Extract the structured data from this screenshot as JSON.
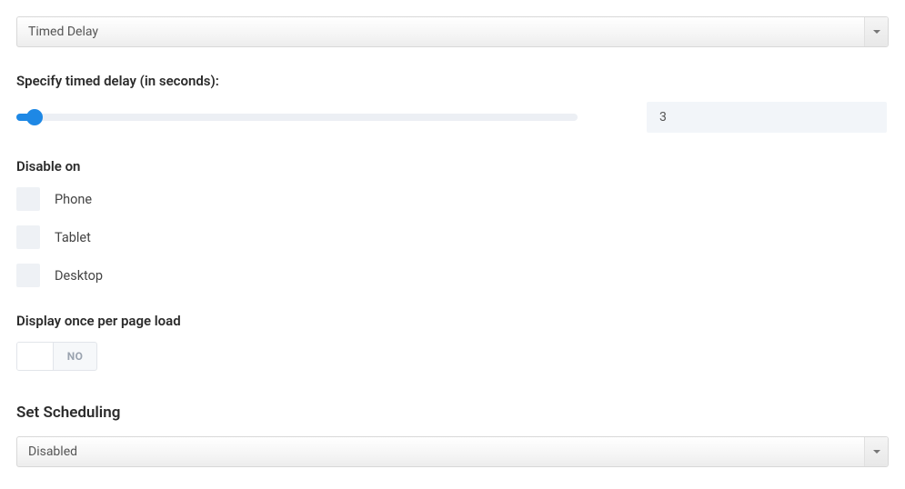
{
  "triggerSelect": {
    "value": "Timed Delay"
  },
  "delay": {
    "label": "Specify timed delay (in seconds):",
    "value": "3"
  },
  "disableOn": {
    "label": "Disable on",
    "options": [
      "Phone",
      "Tablet",
      "Desktop"
    ]
  },
  "displayOnce": {
    "label": "Display once per page load",
    "toggle": "NO"
  },
  "scheduling": {
    "label": "Set Scheduling",
    "value": "Disabled"
  }
}
